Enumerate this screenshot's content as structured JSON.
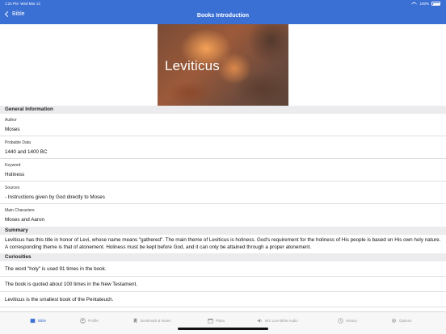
{
  "status": {
    "time": "1:24 PM",
    "date": "Wed Mar 13",
    "battery": "100%"
  },
  "nav": {
    "back_label": "Bible",
    "title": "Books Introduction"
  },
  "hero": {
    "title": "Leviticus"
  },
  "general": {
    "header": "General Information",
    "fields": [
      {
        "key": "Author",
        "value": "Moses"
      },
      {
        "key": "Probable Data",
        "value": "1440 and 1400 BC"
      },
      {
        "key": "Keyword",
        "value": "Holiness"
      },
      {
        "key": "Sources",
        "value": "- Instructions given by God directly to Moses"
      },
      {
        "key": "Main Characters",
        "value": "Moses and Aaron"
      }
    ]
  },
  "summary": {
    "header": "Summary",
    "text": "Leviticus has this title in honor of Levi, whose name means \"gathered\". The main theme of Leviticus is holiness. God's requirement for the holiness of His people is based on His own holy nature. A corresponding theme is that of atonement. Holiness must be kept before God, and it can only be attained through a proper atonement."
  },
  "curiosities": {
    "header": "Curiosities",
    "items": [
      "The word \"holy\" is used 91 times in the book.",
      "The book is quoted about 100 times in the New Testament.",
      "Leviticus is the smallest book of the Pentateuch."
    ]
  },
  "tabbar": {
    "tabs": [
      {
        "label": "Bible",
        "icon": "book-icon",
        "active": true
      },
      {
        "label": "Profile",
        "icon": "profile-icon"
      },
      {
        "label": "Bookmark & Notes",
        "icon": "bookmark-icon"
      },
      {
        "label": "Plans",
        "icon": "calendar-icon"
      },
      {
        "label": "NIV Live Bible Audio",
        "icon": "audio-icon"
      },
      {
        "label": "History",
        "icon": "clock-icon"
      },
      {
        "label": "Options",
        "icon": "gear-icon"
      }
    ]
  },
  "colors": {
    "accent": "#3a6fd4",
    "section_bg": "#ececef",
    "tab_inactive": "#9a9a9a"
  }
}
